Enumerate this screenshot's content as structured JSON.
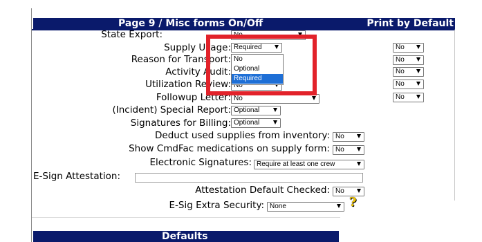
{
  "section": {
    "title": "Page 9 / Misc forms On/Off",
    "print_column_label": "Print by Default"
  },
  "rows": {
    "state_export": {
      "label": "State Export:",
      "value": "No"
    },
    "supply_usage": {
      "label": "Supply Usage:",
      "value": "Required",
      "print": "No",
      "options": [
        "No",
        "Optional",
        "Required"
      ]
    },
    "reason_for_transport": {
      "label": "Reason for Transport:",
      "print": "No"
    },
    "activity_audit": {
      "label": "Activity Audit:",
      "print": "No"
    },
    "utilization_review": {
      "label": "Utilization Review:",
      "value": "No",
      "print": "No"
    },
    "followup_letter": {
      "label": "Followup Letter:",
      "value": "No",
      "print": "No"
    },
    "incident_special_report": {
      "label": "(Incident) Special Report:",
      "value": "Optional"
    },
    "signatures_for_billing": {
      "label": "Signatures for Billing:",
      "value": "Optional"
    },
    "deduct_supplies": {
      "label": "Deduct used supplies from inventory:",
      "value": "No"
    },
    "show_cmdfac": {
      "label": "Show CmdFac medications on supply form:",
      "value": "No"
    },
    "electronic_signatures": {
      "label": "Electronic Signatures:",
      "value": "Require at least one crew"
    },
    "esign_attestation": {
      "label": "E-Sign Attestation:",
      "value": ""
    },
    "attestation_default_checked": {
      "label": "Attestation Default Checked:",
      "value": "No"
    },
    "esig_extra_security": {
      "label": "E-Sig Extra Security:",
      "value": "None"
    }
  },
  "help_icon": {
    "glyph": "?",
    "icon": "help-question-icon",
    "color": "#f0c400"
  },
  "defaults_section": {
    "title": "Defaults"
  },
  "colors": {
    "header_bg": "#0a1a6b",
    "highlight_box": "#e2222a",
    "selected_option": "#1e6fd6"
  }
}
